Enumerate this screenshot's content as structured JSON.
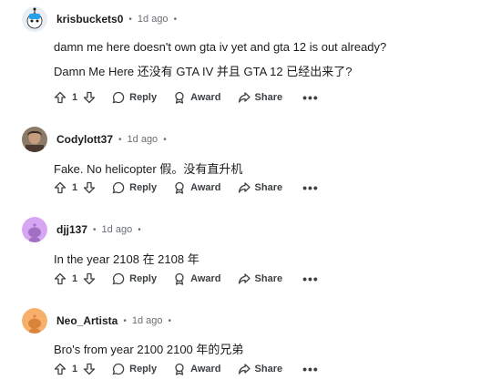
{
  "comments": [
    {
      "author": "krisbuckets0",
      "time": "1d ago",
      "avatar": "snoo-robot-avatar",
      "lines": [
        "damn me here doesn't own gta iv yet and gta 12 is out already?",
        "Damn Me Here 还没有 GTA IV 并且 GTA 12 已经出来了?"
      ],
      "votes": "1",
      "reply": "Reply",
      "award": "Award",
      "share": "Share"
    },
    {
      "author": "Codylott37",
      "time": "1d ago",
      "avatar": "photo-avatar",
      "lines": [
        "Fake. No helicopter  假。没有直升机"
      ],
      "votes": "1",
      "reply": "Reply",
      "award": "Award",
      "share": "Share"
    },
    {
      "author": "djj137",
      "time": "1d ago",
      "avatar": "default-snoo-purple-avatar",
      "lines": [
        "In the year 2108  在 2108 年"
      ],
      "votes": "1",
      "reply": "Reply",
      "award": "Award",
      "share": "Share"
    },
    {
      "author": "Neo_Artista",
      "time": "1d ago",
      "avatar": "default-snoo-orange-avatar",
      "lines": [
        "Bro's from year 2100  2100 年的兄弟"
      ],
      "votes": "1",
      "reply": "Reply",
      "award": "Award",
      "share": "Share"
    }
  ],
  "colors": {
    "text": "#1c1c1c",
    "meta": "#6a6f73",
    "action": "#3c4043",
    "avatar_purple": "#d7a6f2",
    "avatar_orange": "#f7b06b"
  }
}
